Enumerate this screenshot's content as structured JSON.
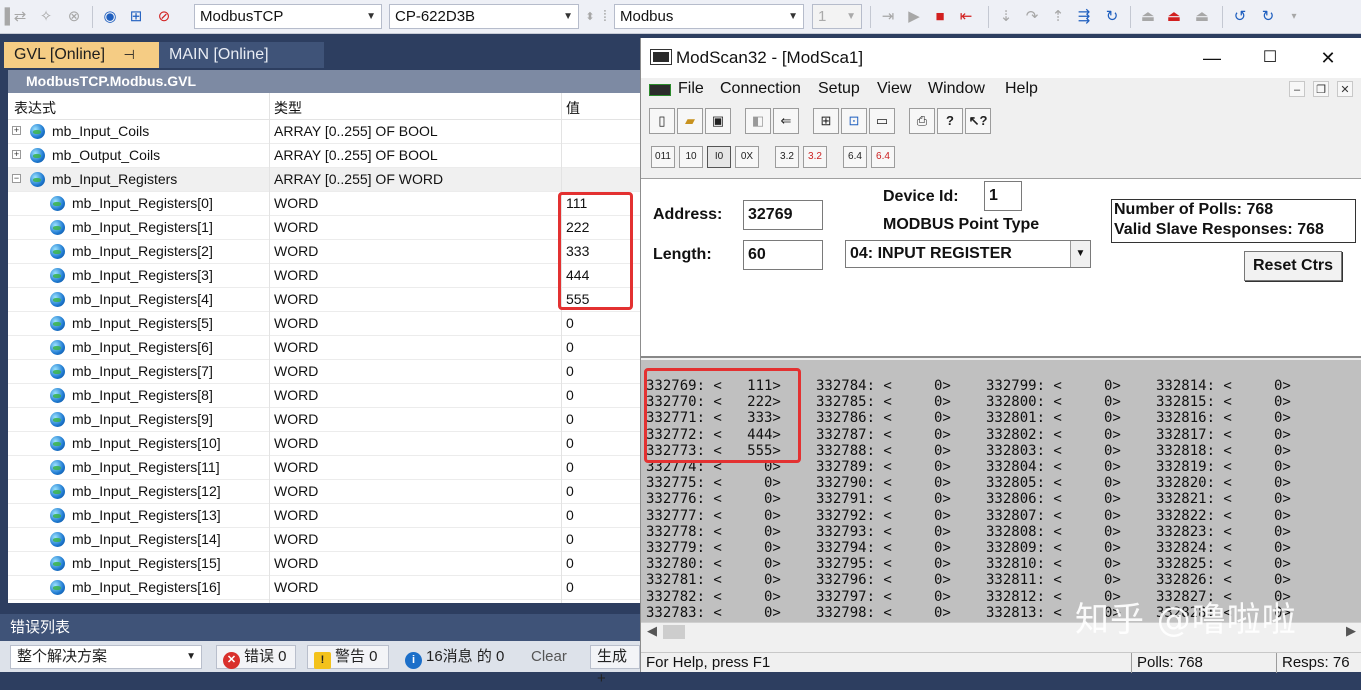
{
  "toolbar": {
    "protocol_combo": "ModbusTCP",
    "device_combo": "CP-622D3B",
    "driver_combo": "Modbus",
    "instance_combo": "1"
  },
  "ide": {
    "tabs": [
      {
        "label": "GVL [Online]",
        "pin": "⊣",
        "close": "✕"
      },
      {
        "label": "MAIN [Online]"
      }
    ],
    "gvl_title": "ModbusTCP.Modbus.GVL",
    "columns": [
      "表达式",
      "类型",
      "值"
    ],
    "rows": [
      {
        "expr": "mb_Input_Coils",
        "type": "ARRAY [0..255] OF BOOL",
        "value": "",
        "expander": "+",
        "indent": 0
      },
      {
        "expr": "mb_Output_Coils",
        "type": "ARRAY [0..255] OF BOOL",
        "value": "",
        "expander": "+",
        "indent": 0
      },
      {
        "expr": "mb_Input_Registers",
        "type": "ARRAY [0..255] OF WORD",
        "value": "",
        "expander": "−",
        "indent": 0,
        "highlight": true
      },
      {
        "expr": "mb_Input_Registers[0]",
        "type": "WORD",
        "value": "111",
        "indent": 1
      },
      {
        "expr": "mb_Input_Registers[1]",
        "type": "WORD",
        "value": "222",
        "indent": 1
      },
      {
        "expr": "mb_Input_Registers[2]",
        "type": "WORD",
        "value": "333",
        "indent": 1
      },
      {
        "expr": "mb_Input_Registers[3]",
        "type": "WORD",
        "value": "444",
        "indent": 1
      },
      {
        "expr": "mb_Input_Registers[4]",
        "type": "WORD",
        "value": "555",
        "indent": 1
      },
      {
        "expr": "mb_Input_Registers[5]",
        "type": "WORD",
        "value": "0",
        "indent": 1
      },
      {
        "expr": "mb_Input_Registers[6]",
        "type": "WORD",
        "value": "0",
        "indent": 1
      },
      {
        "expr": "mb_Input_Registers[7]",
        "type": "WORD",
        "value": "0",
        "indent": 1
      },
      {
        "expr": "mb_Input_Registers[8]",
        "type": "WORD",
        "value": "0",
        "indent": 1
      },
      {
        "expr": "mb_Input_Registers[9]",
        "type": "WORD",
        "value": "0",
        "indent": 1
      },
      {
        "expr": "mb_Input_Registers[10]",
        "type": "WORD",
        "value": "0",
        "indent": 1
      },
      {
        "expr": "mb_Input_Registers[11]",
        "type": "WORD",
        "value": "0",
        "indent": 1
      },
      {
        "expr": "mb_Input_Registers[12]",
        "type": "WORD",
        "value": "0",
        "indent": 1
      },
      {
        "expr": "mb_Input_Registers[13]",
        "type": "WORD",
        "value": "0",
        "indent": 1
      },
      {
        "expr": "mb_Input_Registers[14]",
        "type": "WORD",
        "value": "0",
        "indent": 1
      },
      {
        "expr": "mb_Input_Registers[15]",
        "type": "WORD",
        "value": "0",
        "indent": 1
      },
      {
        "expr": "mb_Input_Registers[16]",
        "type": "WORD",
        "value": "0",
        "indent": 1
      }
    ]
  },
  "error_list": {
    "title": "错误列表",
    "scope": "整个解决方案",
    "errors": "错误 0",
    "warnings": "警告 0",
    "messages": "16消息 的 0",
    "clear": "Clear",
    "build": "生成 +"
  },
  "modscan": {
    "title": "ModScan32 - [ModSca1]",
    "menu": [
      "File",
      "Connection",
      "Setup",
      "View",
      "Window",
      "Help"
    ],
    "address_label": "Address:",
    "address_value": "32769",
    "length_label": "Length:",
    "length_value": "60",
    "device_id_label": "Device Id:",
    "device_id_value": "1",
    "point_type_label": "MODBUS Point Type",
    "point_type_value": "04: INPUT REGISTER",
    "polls": "Number of Polls: 768",
    "valid_responses": "Valid Slave Responses: 768",
    "reset_button": "Reset Ctrs",
    "data_columns": [
      [
        "332769: <   111>",
        "332770: <   222>",
        "332771: <   333>",
        "332772: <   444>",
        "332773: <   555>",
        "332774: <     0>",
        "332775: <     0>",
        "332776: <     0>",
        "332777: <     0>",
        "332778: <     0>",
        "332779: <     0>",
        "332780: <     0>",
        "332781: <     0>",
        "332782: <     0>",
        "332783: <     0>"
      ],
      [
        "332784: <     0>",
        "332785: <     0>",
        "332786: <     0>",
        "332787: <     0>",
        "332788: <     0>",
        "332789: <     0>",
        "332790: <     0>",
        "332791: <     0>",
        "332792: <     0>",
        "332793: <     0>",
        "332794: <     0>",
        "332795: <     0>",
        "332796: <     0>",
        "332797: <     0>",
        "332798: <     0>"
      ],
      [
        "332799: <     0>",
        "332800: <     0>",
        "332801: <     0>",
        "332802: <     0>",
        "332803: <     0>",
        "332804: <     0>",
        "332805: <     0>",
        "332806: <     0>",
        "332807: <     0>",
        "332808: <     0>",
        "332809: <     0>",
        "332810: <     0>",
        "332811: <     0>",
        "332812: <     0>",
        "332813: <     0>"
      ],
      [
        "332814: <     0>",
        "332815: <     0>",
        "332816: <     0>",
        "332817: <     0>",
        "332818: <     0>",
        "332819: <     0>",
        "332820: <     0>",
        "332821: <     0>",
        "332822: <     0>",
        "332823: <     0>",
        "332824: <     0>",
        "332825: <     0>",
        "332826: <     0>",
        "332827: <     0>",
        "332828: <     0>"
      ]
    ],
    "status_help": "For Help, press F1",
    "status_polls": "Polls: 768",
    "status_resps": "Resps: 76"
  },
  "watermark": "知乎 @噜啦啦"
}
